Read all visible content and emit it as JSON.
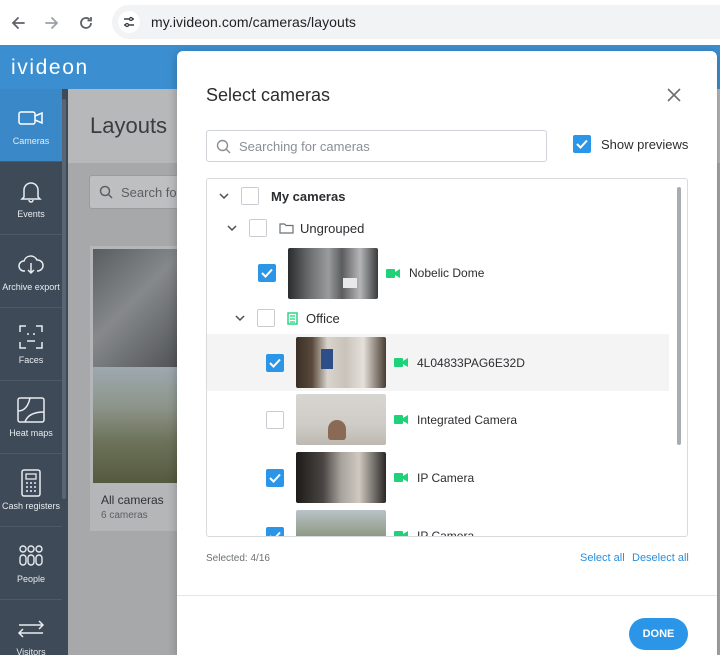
{
  "browser": {
    "url": "my.ivideon.com/cameras/layouts"
  },
  "app": {
    "logo": "ivideon"
  },
  "sidebar": {
    "items": [
      {
        "label": "Cameras",
        "icon": "camera-icon"
      },
      {
        "label": "Events",
        "icon": "bell-icon"
      },
      {
        "label": "Archive export",
        "icon": "cloud-download-icon"
      },
      {
        "label": "Faces",
        "icon": "face-scan-icon"
      },
      {
        "label": "Heat maps",
        "icon": "heatmap-icon"
      },
      {
        "label": "Cash registers",
        "icon": "cash-register-icon"
      },
      {
        "label": "People",
        "icon": "people-icon"
      },
      {
        "label": "Visitors",
        "icon": "arrows-icon"
      }
    ]
  },
  "background": {
    "title": "Layouts",
    "search_placeholder": "Search fo",
    "card_title": "All cameras",
    "card_subtitle": "6 cameras"
  },
  "modal": {
    "title": "Select cameras",
    "search_placeholder": "Searching for cameras",
    "show_previews_label": "Show previews",
    "show_previews_checked": true,
    "tree": {
      "root_label": "My cameras",
      "groups": [
        {
          "label": "Ungrouped",
          "cameras": [
            {
              "name": "Nobelic Dome",
              "checked": true
            }
          ]
        },
        {
          "label": "Office",
          "cameras": [
            {
              "name": "4L04833PAG6E32D",
              "checked": true
            },
            {
              "name": "Integrated Camera",
              "checked": false
            },
            {
              "name": "IP Camera",
              "checked": true
            },
            {
              "name": "IP Camera",
              "checked": true
            }
          ]
        }
      ]
    },
    "selected_text": "Selected: 4/16",
    "select_all": "Select all",
    "deselect_all": "Deselect all",
    "done": "DONE"
  },
  "colors": {
    "accent": "#2b96e8",
    "header": "#3b8fd0",
    "sidebar": "#3e4a57",
    "camera_online": "#1fd279"
  }
}
